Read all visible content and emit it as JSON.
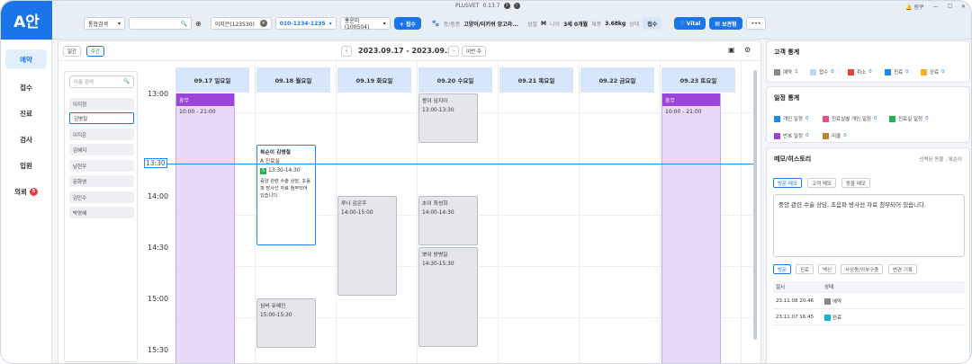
{
  "app": {
    "logo": "A안",
    "brand": "PLUSVET",
    "version": "0.13.7",
    "help_glyph": "?",
    "info_glyph": "!",
    "user_menu": "원쿠",
    "colors": {
      "accent": "#1a75e8",
      "holiday": "#9c43d8",
      "now_line": "#1a8af0"
    }
  },
  "topbar": {
    "search_type": "통합검색",
    "patient": "이지은(123530)",
    "phone": "010-1234-1235",
    "doctor": "홍윤미(100504)",
    "reception_btn": "+ 접수",
    "species_label": "종/품종",
    "species": "고양이/터키쉬 앙고라...",
    "sex_label": "성별",
    "sex": "M",
    "age_label": "나이",
    "age": "3세 0개월",
    "weight_label": "체중",
    "weight": "3.68kg",
    "status_label": "상태",
    "status": "접수",
    "vital_btn": "Vital",
    "insurance_btn": "보관함",
    "more": "•••"
  },
  "sidebar": {
    "items": [
      {
        "label": "예약"
      },
      {
        "label": "접수"
      },
      {
        "label": "진료"
      },
      {
        "label": "검사"
      },
      {
        "label": "입원"
      },
      {
        "label": "의뢰",
        "badge": "5"
      }
    ]
  },
  "schedule": {
    "view_day": "일간",
    "view_week": "주간",
    "date_range": "2023.09.17 - 2023.09.23",
    "this_week": "이번 주",
    "name_search_placeholder": "이름 검색",
    "names": [
      "이지정",
      "김병철",
      "이지은",
      "김혜지",
      "남현우",
      "문화영",
      "김민수",
      "박영혜"
    ],
    "days": [
      "09.17 일요일",
      "09.18 월요일",
      "09.19 화요일",
      "09.20 수요일",
      "09.21 목요일",
      "09.22 금요일",
      "09.23 토요일"
    ],
    "times": [
      "13:00",
      "13:30",
      "14:00",
      "14:30",
      "15:00",
      "15:30"
    ],
    "now": "13:30",
    "holidays": [
      {
        "label": "휴무",
        "time": "10:00 - 21:00"
      },
      {
        "label": "휴무",
        "time": "10:00 - 21:00"
      }
    ],
    "appointments": [
      {
        "name": "몽이 임지아",
        "time": "13:00-13:30"
      },
      {
        "name": "복순이 김병철",
        "sub": "A 진료실",
        "badge": "S",
        "time": "13:30-14:30",
        "memo": "중양 관련 수술 상담, 초음파 방사선 자료 첨부되어 있습니다."
      },
      {
        "name": "루나 김은주",
        "time": "14:00-15:00"
      },
      {
        "name": "초이 최성희",
        "time": "14:00-14:30"
      },
      {
        "name": "뽀이 방병일",
        "time": "14:30-15:30"
      },
      {
        "name": "심바 유혜진",
        "time": "15:00-15:30"
      }
    ]
  },
  "customer_stats": {
    "title": "고객 통계",
    "items": [
      {
        "label": "예약",
        "count": "1",
        "color": "#888888"
      },
      {
        "label": "접수",
        "count": "0",
        "color": "#bcd7f5"
      },
      {
        "label": "취소",
        "count": "0",
        "color": "#e84040"
      },
      {
        "label": "진료",
        "count": "0",
        "color": "#1a8af0"
      },
      {
        "label": "완료",
        "count": "0",
        "color": "#f0b020"
      }
    ]
  },
  "schedule_stats": {
    "title": "일정 통계",
    "items": [
      {
        "label": "개인 일정",
        "count": "0",
        "color": "#1a8af0"
      },
      {
        "label": "진료실별 개인 일정",
        "count": "0",
        "color": "#e84c8a"
      },
      {
        "label": "진료실 일정",
        "count": "0",
        "color": "#22b24c"
      },
      {
        "label": "반복 일정",
        "count": "0",
        "color": "#9c43d8"
      },
      {
        "label": "리콜",
        "count": "0",
        "color": "#b8863a"
      }
    ]
  },
  "memo": {
    "title": "메모/히스토리",
    "selected": "선택된 동물 : 복순이",
    "tabs": [
      "방문 메모",
      "고객 메모",
      "동물 메모"
    ],
    "text": "중양 관련 수술 상담, 초음파 방사선 자료 첨부되어 있습니다.",
    "history_tabs": [
      "방문",
      "진료",
      "백신",
      "사상충/외부구충",
      "변경 기록"
    ],
    "col_date": "일시",
    "col_status": "상태",
    "rows": [
      {
        "date": "23.11.08 20:46",
        "status": "예약",
        "color": "#888888"
      },
      {
        "date": "23.11.07 16:45",
        "status": "완료",
        "color": "#14b8c8"
      }
    ]
  }
}
